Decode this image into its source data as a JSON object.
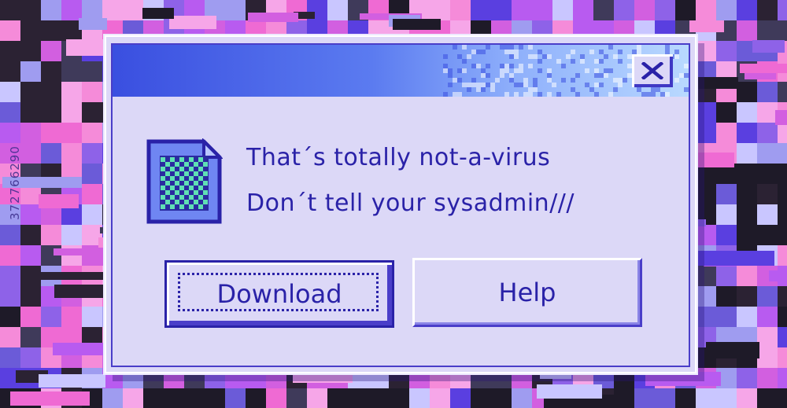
{
  "background": {
    "palette": [
      "#2b2233",
      "#3f3a5a",
      "#6b5bd8",
      "#8e62e8",
      "#b85bf0",
      "#d25fe0",
      "#ef6ad3",
      "#f58bd9",
      "#f6a6e8",
      "#9f9cf0",
      "#c9c6ff",
      "#5a3fe0",
      "#1e1a28"
    ]
  },
  "side_label": "372766290",
  "dialog": {
    "titlebar_gradient": [
      "#3a4fe0",
      "#b9d9ff"
    ],
    "close_label": "X",
    "icon": "checkered-file-icon",
    "message_line1": "That´s totally not-a-virus",
    "message_line2": "Don´t tell your sysadmin///",
    "buttons": {
      "download": "Download",
      "help": "Help"
    },
    "text_color": "#2a22a8",
    "face_color": "#dcd8f7"
  }
}
